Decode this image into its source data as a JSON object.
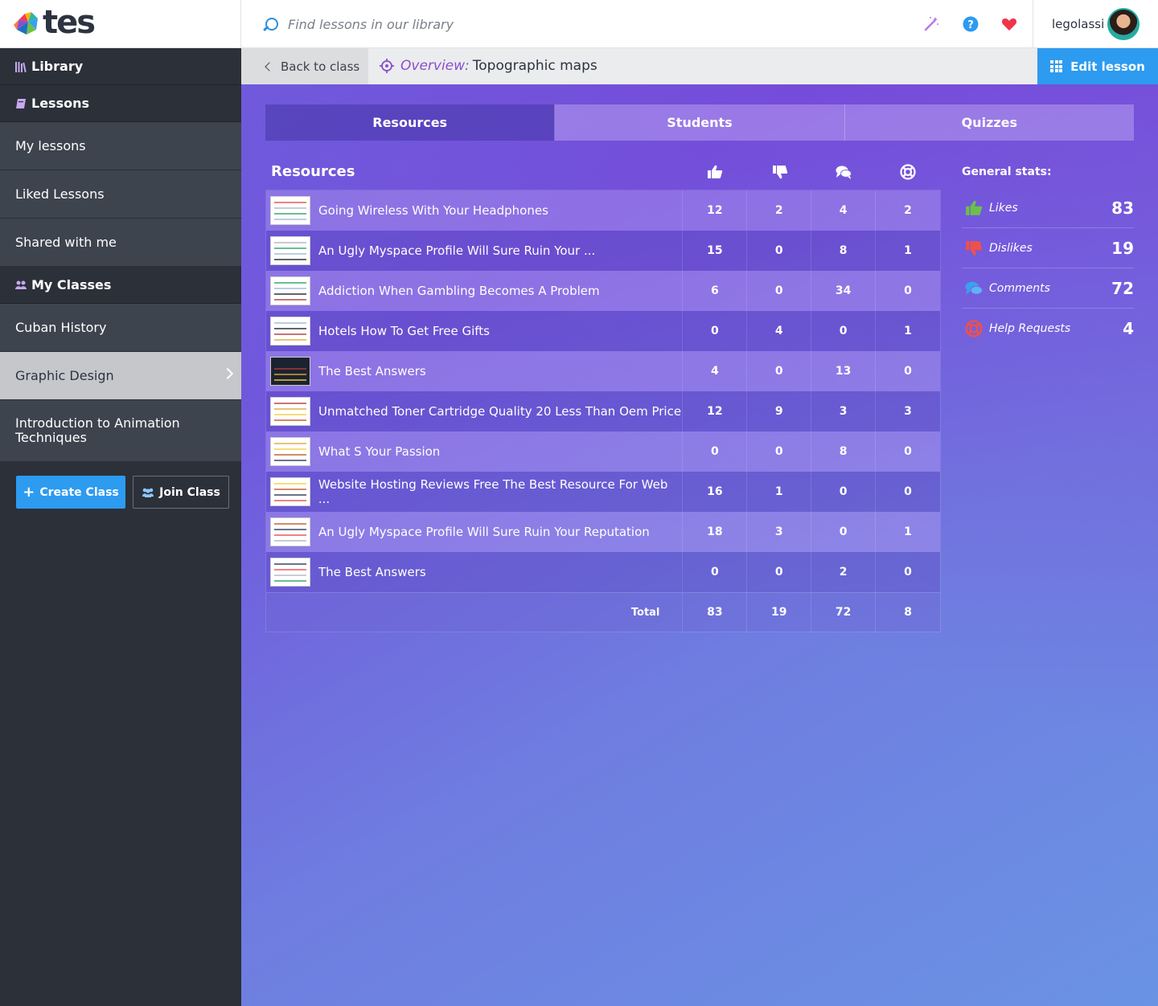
{
  "header": {
    "logo_text": "tes",
    "search_placeholder": "Find lessons in our library",
    "username": "legolassi"
  },
  "sidebar": {
    "library_label": "Library",
    "lessons_label": "Lessons",
    "lesson_items": [
      "My lessons",
      "Liked Lessons",
      "Shared with me"
    ],
    "classes_label": "My Classes",
    "class_items": [
      "Cuban History",
      "Graphic Design",
      "Introduction to Animation Techniques"
    ],
    "create_class": "Create Class",
    "join_class": "Join Class"
  },
  "subbar": {
    "back_label": "Back to class",
    "overview_label": "Overview:",
    "lesson_title": "Topographic maps",
    "edit_label": "Edit lesson"
  },
  "tabs": [
    "Resources",
    "Students",
    "Quizzes"
  ],
  "table": {
    "title": "Resources",
    "rows": [
      {
        "name": "Going Wireless With Your Headphones",
        "likes": "12",
        "dislikes": "2",
        "comments": "4",
        "help": "2"
      },
      {
        "name": "An Ugly Myspace Profile Will Sure Ruin Your ...",
        "likes": "15",
        "dislikes": "0",
        "comments": "8",
        "help": "1"
      },
      {
        "name": "Addiction When Gambling Becomes A Problem",
        "likes": "6",
        "dislikes": "0",
        "comments": "34",
        "help": "0"
      },
      {
        "name": "Hotels How To Get Free Gifts",
        "likes": "0",
        "dislikes": "4",
        "comments": "0",
        "help": "1"
      },
      {
        "name": "The Best Answers",
        "likes": "4",
        "dislikes": "0",
        "comments": "13",
        "help": "0"
      },
      {
        "name": "Unmatched Toner Cartridge Quality 20 Less Than Oem Price",
        "likes": "12",
        "dislikes": "9",
        "comments": "3",
        "help": "3"
      },
      {
        "name": "What S Your Passion",
        "likes": "0",
        "dislikes": "0",
        "comments": "8",
        "help": "0"
      },
      {
        "name": "Website Hosting Reviews Free The Best Resource For Web ...",
        "likes": "16",
        "dislikes": "1",
        "comments": "0",
        "help": "0"
      },
      {
        "name": "An Ugly Myspace Profile Will Sure Ruin Your Reputation",
        "likes": "18",
        "dislikes": "3",
        "comments": "0",
        "help": "1"
      },
      {
        "name": "The Best Answers",
        "likes": "0",
        "dislikes": "0",
        "comments": "2",
        "help": "0"
      }
    ],
    "total_label": "Total",
    "totals": {
      "likes": "83",
      "dislikes": "19",
      "comments": "72",
      "help": "8"
    }
  },
  "stats": {
    "title": "General stats:",
    "items": [
      {
        "label": "Likes",
        "value": "83",
        "icon": "thumbs-up-icon",
        "color": "#6cc04a"
      },
      {
        "label": "Dislikes",
        "value": "19",
        "icon": "thumbs-down-icon",
        "color": "#f0504a"
      },
      {
        "label": "Comments",
        "value": "72",
        "icon": "comments-icon",
        "color": "#3ba0f0"
      },
      {
        "label": "Help Requests",
        "value": "4",
        "icon": "lifebuoy-icon",
        "color": "#f0504a"
      }
    ]
  },
  "colors": {
    "accent": "#2d9bf0",
    "sidebar": "#2b3039",
    "overview": "#8a4fd0"
  }
}
